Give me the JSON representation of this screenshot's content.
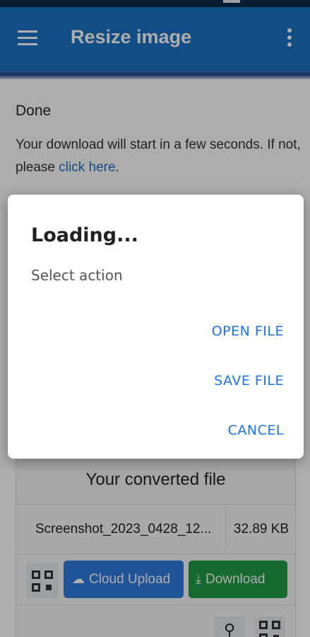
{
  "app_bar": {
    "title": "Resize image",
    "menu_icon": "hamburger-menu-icon",
    "overflow_icon": "more-vert-icon",
    "color": "#1b74c4"
  },
  "status": {
    "heading": "Done",
    "message_prefix": "Your download will start in a few seconds. If not, please ",
    "message_link": "click here",
    "message_suffix": "."
  },
  "file_card": {
    "header": "Your converted file",
    "file_name": "Screenshot_2023_0428_12...",
    "file_size": "32.89 KB",
    "cloud_upload_label": "Cloud Upload",
    "download_label": "Download",
    "qr_icon": "qr-code-icon",
    "search_icon": "search-icon",
    "cloud_icon": "cloud-upload-icon",
    "download_icon": "download-icon",
    "cloud_color": "#2f7ce0",
    "download_color": "#1f9e46"
  },
  "dialog": {
    "title": "Loading...",
    "message": "Select action",
    "actions": [
      "OPEN FILE",
      "SAVE FILE",
      "CANCEL"
    ],
    "action_color": "#1a73e8"
  }
}
